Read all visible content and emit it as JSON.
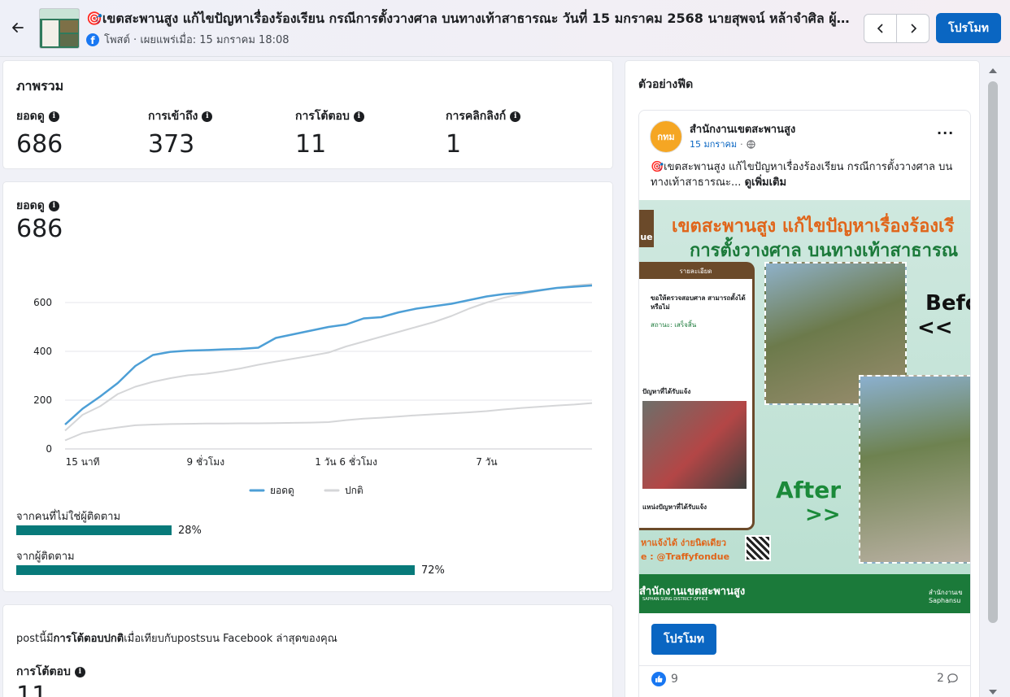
{
  "header": {
    "title": "🎯เขตสะพานสูง แก้ไขปัญหาเรื่องร้องเรียน กรณีการตั้งวางศาล บนทางเท้าสาธารณะ วันที่ 15 มกราคม 2568 นายสุพจน์ หล้าจำศิล ผู้อำนวยการเขตสะพานสูง",
    "subtitle": "โพสต์ · เผยแพร่เมื่อ: 15 มกราคม 18:08",
    "promote_label": "โปรโมท"
  },
  "overview": {
    "title": "ภาพรวม",
    "metrics": [
      {
        "label": "ยอดดู",
        "value": "686"
      },
      {
        "label": "การเข้าถึง",
        "value": "373"
      },
      {
        "label": "การโต้ตอบ",
        "value": "11"
      },
      {
        "label": "การคลิกลิงก์",
        "value": "1"
      }
    ]
  },
  "views_chart": {
    "label": "ยอดดู",
    "value": "686",
    "bars": [
      {
        "label": "จากคนที่ไม่ใช่ผู้ติดตาม",
        "percent_label": "28%",
        "fraction": 0.28
      },
      {
        "label": "จากผู้ติดตาม",
        "percent_label": "72%",
        "fraction": 0.72
      }
    ]
  },
  "chart_data": {
    "type": "line",
    "title": "",
    "xlabel": "",
    "ylabel": "",
    "ylim": [
      0,
      700
    ],
    "yticks": [
      0,
      200,
      400,
      600
    ],
    "grid": true,
    "legend_position": "bottom",
    "x_tick_labels": [
      "15 นาที",
      "9 ชั่วโมง",
      "1 วัน 6 ชั่วโมง",
      "7 วัน"
    ],
    "x_tick_positions": [
      1,
      8,
      16,
      24
    ],
    "x": [
      0,
      1,
      2,
      3,
      4,
      5,
      6,
      7,
      8,
      9,
      10,
      11,
      12,
      13,
      14,
      15,
      16,
      17,
      18,
      19,
      20,
      21,
      22,
      23,
      24,
      25,
      26,
      27,
      28,
      29,
      30
    ],
    "series": [
      {
        "name": "ยอดดู",
        "color": "#4d9fd6",
        "values": [
          100,
          165,
          215,
          270,
          340,
          385,
          398,
          403,
          405,
          408,
          410,
          415,
          455,
          470,
          485,
          500,
          510,
          535,
          540,
          560,
          575,
          585,
          595,
          610,
          625,
          635,
          640,
          650,
          660,
          665,
          670
        ]
      },
      {
        "name": "ปกติ",
        "color": "#d5d6d8",
        "values": [
          75,
          140,
          175,
          225,
          255,
          275,
          290,
          302,
          308,
          318,
          330,
          345,
          358,
          370,
          382,
          395,
          420,
          440,
          460,
          480,
          500,
          520,
          545,
          575,
          600,
          620,
          635,
          648,
          660,
          670,
          676
        ]
      },
      {
        "name": "",
        "color": "#d5d6d8",
        "values": [
          35,
          65,
          78,
          88,
          97,
          100,
          102,
          103,
          104,
          104,
          105,
          105,
          106,
          107,
          108,
          110,
          118,
          124,
          128,
          133,
          138,
          142,
          146,
          150,
          155,
          162,
          168,
          173,
          178,
          182,
          188
        ]
      }
    ],
    "legend": [
      "ยอดดู",
      "ปกติ"
    ]
  },
  "comparison": {
    "sentence_prefix": "postนี้มี",
    "sentence_bold": "การโต้ตอบปกติ",
    "sentence_suffix": "เมื่อเทียบกับpostsบน Facebook ล่าสุดของคุณ",
    "metric_label": "การโต้ตอบ",
    "metric_value": "11"
  },
  "feed_preview": {
    "title": "ตัวอย่างฟีด",
    "page_name": "สำนักงานเขตสะพานสูง",
    "date": "15 มกราคม",
    "avatar_text": "กทม",
    "body": "🎯เขตสะพานสูง แก้ไขปัญหาเรื่องร้องเรียน กรณีการตั้งวางศาล บนทางเท้าสาธารณะ...",
    "see_more": "ดูเพิ่มเติม",
    "image_headline_1": "เขตสะพานสูง แก้ไขปัญหาเรื่องร้องเรี",
    "image_headline_2": "การตั้งวางศาล บนทางเท้าสาธารณ",
    "image_before": "Befo",
    "image_before_arrows": "<<",
    "image_after": "After",
    "image_after_arrows": ">>",
    "image_office": "สำนักงานเขตสะพานสูง",
    "image_office_en": "SAPHAN SUNG DISTRICT OFFICE",
    "image_traffy": "e : @Traffyfondue",
    "image_traffy_line1": "หาแจ้งได้ ง่ายนิดเดียว",
    "image_form_header": "รายละเอียด",
    "image_form_line1": "ขอให้ตรวจสอบศาล สามารถตั้งได้หรือไม่",
    "image_form_status": "สถานะ: เสร็จสิ้น",
    "image_problem_label": "ปัญหาที่ได้รับแจ้ง",
    "image_problem_place": "แหน่งปัญหาที่ได้รับแจ้ง",
    "image_side_label": "ue",
    "image_footer_right_1": "สำนักงานเข",
    "image_footer_right_2": "Saphansu",
    "promote_label": "โปรโมท",
    "likes": "9",
    "comments": "2"
  },
  "colors": {
    "accent": "#0a66c2",
    "bar": "#087a7a",
    "series_main": "#4d9fd6",
    "series_typical": "#d5d6d8"
  }
}
